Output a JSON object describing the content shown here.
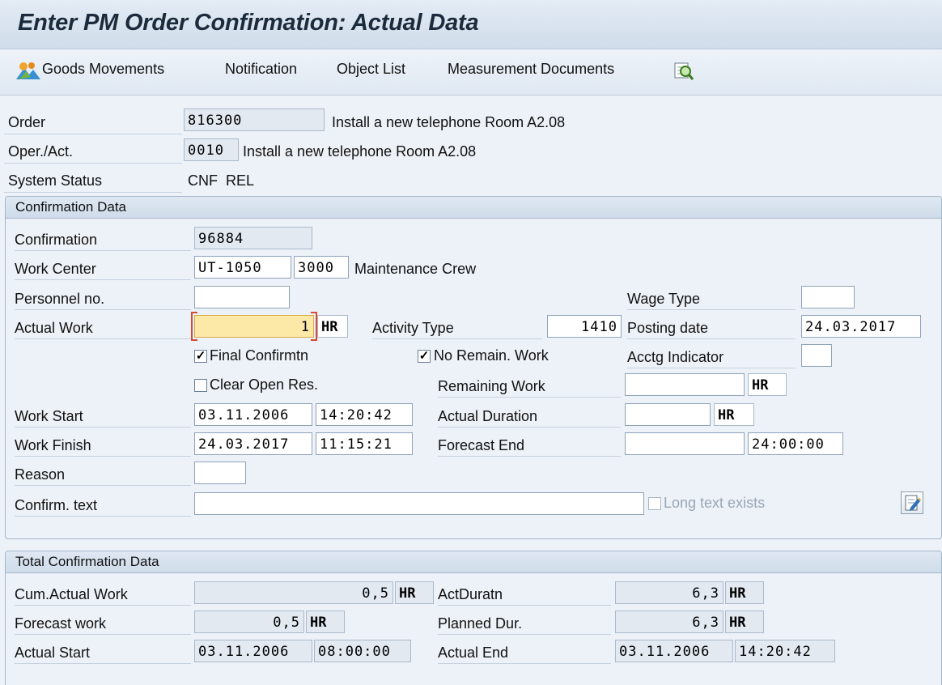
{
  "window": {
    "title": "Enter PM Order Confirmation: Actual Data"
  },
  "toolbar": {
    "goods_movements": "Goods Movements",
    "notification": "Notification",
    "object_list": "Object List",
    "measurement_documents": "Measurement Documents"
  },
  "header": {
    "order_label": "Order",
    "order_value": "816300",
    "order_desc": "Install a new telephone Room A2.08",
    "operation_label": "Oper./Act.",
    "operation_value": "0010",
    "operation_desc": "Install a new telephone Room A2.08",
    "status_label": "System Status",
    "status_value": "CNF  REL"
  },
  "confirmation": {
    "group_title": "Confirmation Data",
    "confirmation_label": "Confirmation",
    "confirmation_value": "96884",
    "work_center_label": "Work Center",
    "work_center_value": "UT-1050",
    "plant_value": "3000",
    "work_center_desc": "Maintenance Crew",
    "personnel_label": "Personnel no.",
    "personnel_value": "",
    "wage_type_label": "Wage Type",
    "wage_type_value": "",
    "actual_work_label": "Actual Work",
    "actual_work_value": "1",
    "actual_work_unit": "HR",
    "activity_type_label": "Activity Type",
    "activity_type_value": "1410",
    "posting_date_label": "Posting date",
    "posting_date_value": "24.03.2017",
    "final_confirmation_label": "Final Confirmtn",
    "final_confirmation_checked": true,
    "no_remaining_work_label": "No Remain. Work",
    "no_remaining_work_checked": true,
    "acctg_indicator_label": "Acctg Indicator",
    "acctg_indicator_value": "",
    "clear_open_res_label": "Clear Open Res.",
    "clear_open_res_checked": false,
    "remaining_work_label": "Remaining Work",
    "remaining_work_value": "",
    "remaining_work_unit": "HR",
    "work_start_label": "Work Start",
    "work_start_date": "03.11.2006",
    "work_start_time": "14:20:42",
    "actual_duration_label": "Actual Duration",
    "actual_duration_value": "",
    "actual_duration_unit": "HR",
    "work_finish_label": "Work Finish",
    "work_finish_date": "24.03.2017",
    "work_finish_time": "11:15:21",
    "forecast_end_label": "Forecast End",
    "forecast_end_date": "",
    "forecast_end_time": "24:00:00",
    "reason_label": "Reason",
    "reason_value": "",
    "confirm_text_label": "Confirm. text",
    "confirm_text_value": "",
    "long_text_label": "Long text exists",
    "long_text_checked": false
  },
  "totals": {
    "group_title": "Total Confirmation Data",
    "cum_actual_work_label": "Cum.Actual Work",
    "cum_actual_work_value": "0,5",
    "cum_actual_work_unit": "HR",
    "act_duration_label": "ActDuratn",
    "act_duration_value": "6,3",
    "act_duration_unit": "HR",
    "forecast_work_label": "Forecast work",
    "forecast_work_value": "0,5",
    "forecast_work_unit": "HR",
    "planned_dur_label": "Planned Dur.",
    "planned_dur_value": "6,3",
    "planned_dur_unit": "HR",
    "actual_start_label": "Actual Start",
    "actual_start_date": "03.11.2006",
    "actual_start_time": "08:00:00",
    "actual_end_label": "Actual End",
    "actual_end_date": "03.11.2006",
    "actual_end_time": "14:20:42"
  },
  "icons": {
    "goods": "mountain-people-icon",
    "find": "find-icon",
    "long_text": "edit-long-text-icon"
  }
}
